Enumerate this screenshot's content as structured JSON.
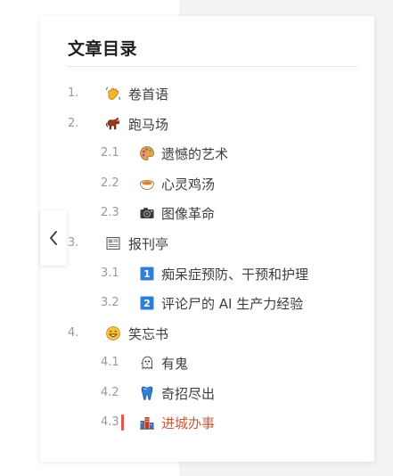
{
  "toc": {
    "title": "文章目录",
    "items": [
      {
        "num": "1.",
        "label": "卷首语",
        "icon": "waving-hand-icon",
        "level": 1
      },
      {
        "num": "2.",
        "label": "跑马场",
        "icon": "horse-icon",
        "level": 1
      },
      {
        "num": "2.1",
        "label": "遗憾的艺术",
        "icon": "artist-palette-icon",
        "level": 2
      },
      {
        "num": "2.2",
        "label": "心灵鸡汤",
        "icon": "soup-bowl-icon",
        "level": 2
      },
      {
        "num": "2.3",
        "label": "图像革命",
        "icon": "camera-icon",
        "level": 2
      },
      {
        "num": "3.",
        "label": "报刊亭",
        "icon": "newspaper-icon",
        "level": 1
      },
      {
        "num": "3.1",
        "label": "痴呆症预防、干预和护理",
        "icon": "keycap-1-icon",
        "level": 2
      },
      {
        "num": "3.2",
        "label": "评论尸的 AI 生产力经验",
        "icon": "keycap-2-icon",
        "level": 2
      },
      {
        "num": "4.",
        "label": "笑忘书",
        "icon": "grinning-face-icon",
        "level": 1
      },
      {
        "num": "4.1",
        "label": "有鬼",
        "icon": "ghost-icon",
        "level": 2
      },
      {
        "num": "4.2",
        "label": "奇招尽出",
        "icon": "tooth-icon",
        "level": 2
      },
      {
        "num": "4.3",
        "label": "进城办事",
        "icon": "city-icon",
        "level": 2,
        "active": true
      }
    ]
  },
  "colors": {
    "active_text": "#c65b3d",
    "active_marker": "#e0584b",
    "text": "#3d3d3d",
    "number": "#9a9a9a"
  },
  "collapse_icon": "chevron-left-icon"
}
